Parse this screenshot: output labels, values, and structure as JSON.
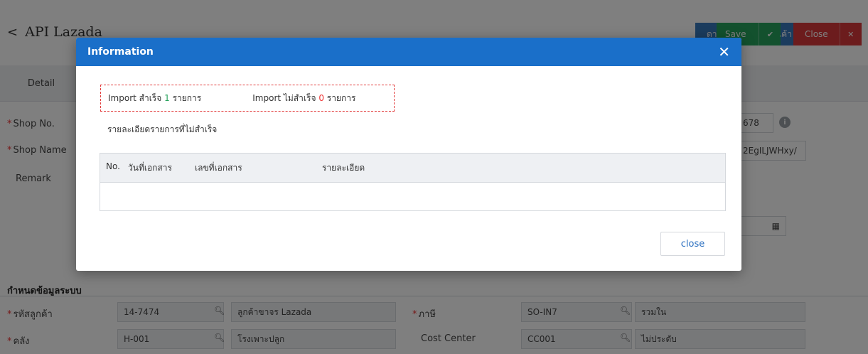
{
  "page": {
    "title": "API Lazada",
    "buttons": {
      "download_label": "ดาวน์โหลดข้อมูลสินค้า",
      "save_label": "Save",
      "close_label": "Close"
    },
    "tab_detail": "Detail",
    "fields": {
      "shop_no_label": "Shop No.",
      "shop_no_value": "678",
      "shop_name_label": "Shop Name",
      "shop_name_value": "2EgILJWHxy/",
      "remark_label": "Remark"
    },
    "section_title": "กำหนดข้อมูลระบบ",
    "rows": [
      {
        "label": "รหัสลูกค้า",
        "required": true,
        "code": "14-7474",
        "desc": "ลูกค้าขาจร Lazada",
        "label2": "ภาษี",
        "required2": true,
        "code2": "SO-IN7",
        "desc2": "รวมใน"
      },
      {
        "label": "คลัง",
        "required": true,
        "code": "H-001",
        "desc": "โรงเพาะปลูก",
        "label2": "Cost Center",
        "required2": false,
        "code2": "CC001",
        "desc2": "ไม่ประดับ"
      }
    ]
  },
  "modal": {
    "title": "Information",
    "success_prefix": "Import สำเร็จ",
    "success_count": "1",
    "success_suffix": "รายการ",
    "fail_prefix": "Import ไม่สำเร็จ",
    "fail_count": "0",
    "fail_suffix": "รายการ",
    "fail_detail_label": "รายละเอียดรายการที่ไม่สำเร็จ",
    "columns": [
      "No.",
      "วันที่เอกสาร",
      "เลขที่เอกสาร",
      "รายละเอียด"
    ],
    "close_label": "close"
  },
  "colors": {
    "header_blue": "#1a6fc9",
    "success": "#27a35d",
    "danger": "#e33b3b"
  }
}
